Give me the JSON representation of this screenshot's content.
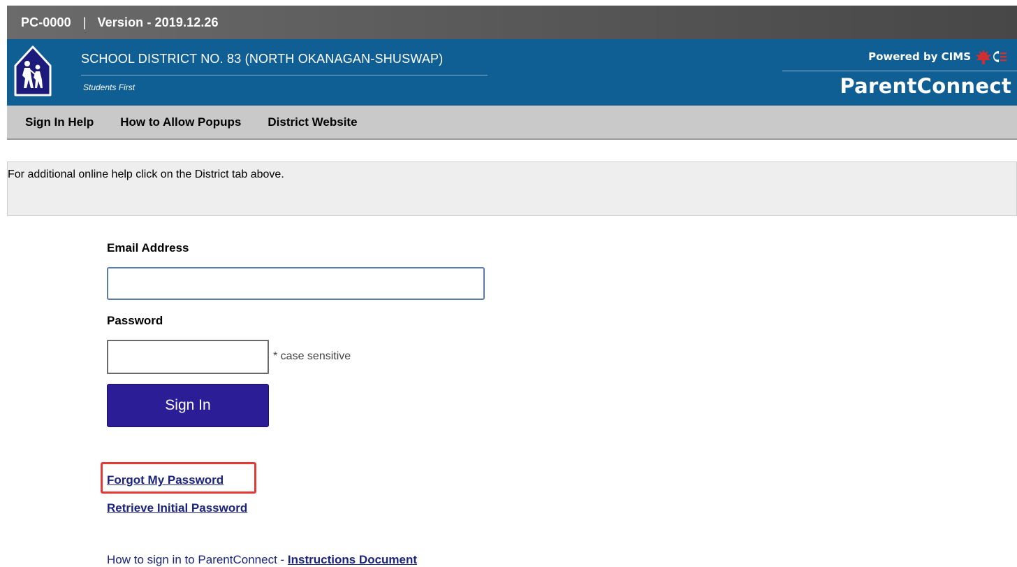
{
  "topbar": {
    "app_code": "PC-0000",
    "separator": "|",
    "version": "Version - 2019.12.26"
  },
  "banner": {
    "district_name": "SCHOOL DISTRICT NO. 83 (NORTH OKANAGAN-SHUSWAP)",
    "motto": "Students First",
    "powered_by": "Powered by CIMS",
    "product_name": "ParentConnect",
    "logo_icon": "school-crossing-sign-icon",
    "cims_icon": "maple-leaf-icon",
    "colors": {
      "banner": "#0f5f94",
      "topbar": "#5a5a5a",
      "nav": "#c9c9c9"
    }
  },
  "nav": {
    "items": [
      {
        "label": "Sign In Help"
      },
      {
        "label": "How to Allow Popups"
      },
      {
        "label": "District Website"
      }
    ]
  },
  "info": {
    "message": "For additional online help click on the District tab above."
  },
  "form": {
    "email_label": "Email Address",
    "email_value": "",
    "password_label": "Password",
    "password_value": "",
    "password_note": "* case sensitive",
    "signin_label": "Sign In",
    "signin_color": "#2b1d96"
  },
  "links": {
    "forgot_password": "Forgot My Password",
    "retrieve_password": "Retrieve Initial Password",
    "howto_prefix": "How to sign in to ParentConnect - ",
    "instructions": "Instructions Document",
    "link_color": "#1a237e",
    "highlight_color": "#e53935"
  }
}
